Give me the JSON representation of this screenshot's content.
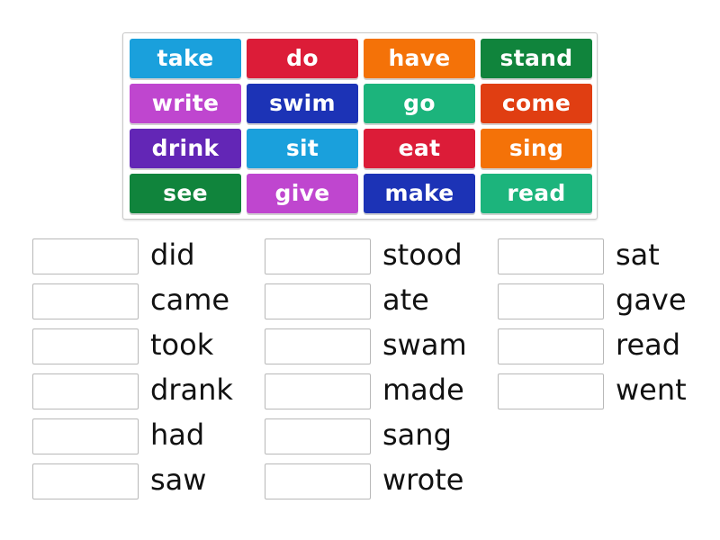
{
  "tiles": [
    {
      "label": "take",
      "color": "#1aa0dc"
    },
    {
      "label": "do",
      "color": "#dc1c38"
    },
    {
      "label": "have",
      "color": "#f47208"
    },
    {
      "label": "stand",
      "color": "#10843c"
    },
    {
      "label": "write",
      "color": "#bf46cf"
    },
    {
      "label": "swim",
      "color": "#1c33b6"
    },
    {
      "label": "go",
      "color": "#1cb47c"
    },
    {
      "label": "come",
      "color": "#e03e12"
    },
    {
      "label": "drink",
      "color": "#6326b6"
    },
    {
      "label": "sit",
      "color": "#1aa0dc"
    },
    {
      "label": "eat",
      "color": "#dc1c38"
    },
    {
      "label": "sing",
      "color": "#f47208"
    },
    {
      "label": "see",
      "color": "#10843c"
    },
    {
      "label": "give",
      "color": "#bf46cf"
    },
    {
      "label": "make",
      "color": "#1c33b6"
    },
    {
      "label": "read",
      "color": "#1cb47c"
    }
  ],
  "columns": [
    [
      "did",
      "came",
      "took",
      "drank",
      "had",
      "saw"
    ],
    [
      "stood",
      "ate",
      "swam",
      "made",
      "sang",
      "wrote"
    ],
    [
      "sat",
      "gave",
      "read",
      "went"
    ]
  ]
}
